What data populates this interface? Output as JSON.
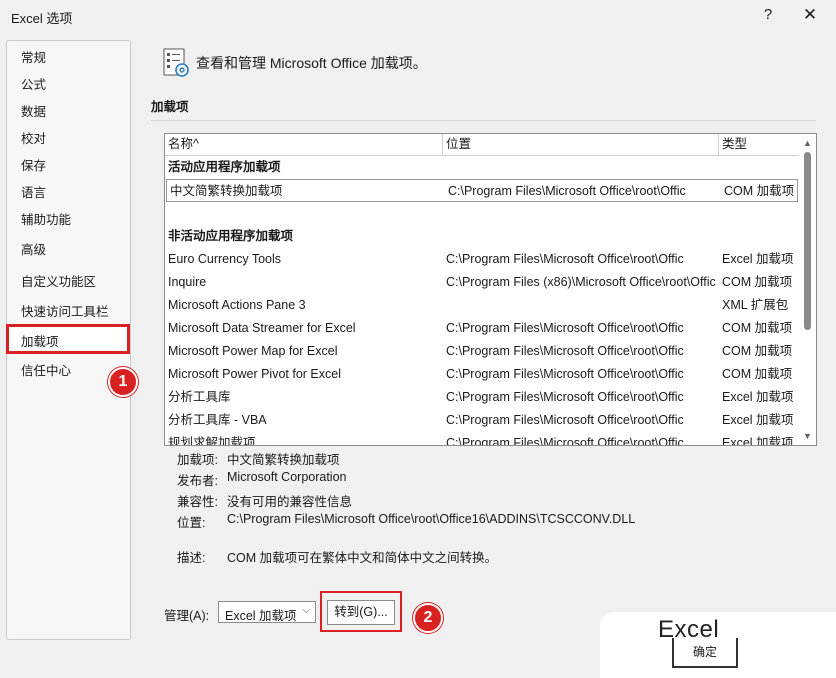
{
  "window": {
    "title": "Excel 选项",
    "help": "?",
    "close": "✕"
  },
  "sidebar": {
    "items": [
      {
        "label": "常规"
      },
      {
        "label": "公式"
      },
      {
        "label": "数据"
      },
      {
        "label": "校对"
      },
      {
        "label": "保存"
      },
      {
        "label": "语言"
      },
      {
        "label": "辅助功能"
      },
      {
        "label": "高级"
      },
      {
        "label": "自定义功能区"
      },
      {
        "label": "快速访问工具栏"
      },
      {
        "label": "加载项"
      },
      {
        "label": "信任中心"
      }
    ],
    "selected_label": "加载项"
  },
  "badges": {
    "one": "1",
    "two": "2"
  },
  "header": {
    "text": "查看和管理 Microsoft Office 加载项。"
  },
  "section": {
    "title": "加载项"
  },
  "list": {
    "columns": {
      "name": "名称^",
      "location": "位置",
      "type": "类型"
    },
    "active_group": "活动应用程序加载项",
    "inactive_group": "非活动应用程序加载项",
    "active_rows": [
      {
        "name": "中文简繁转换加载项",
        "location": "C:\\Program Files\\Microsoft Office\\root\\Offic",
        "type": "COM 加载项"
      }
    ],
    "inactive_rows": [
      {
        "name": "Euro Currency Tools",
        "location": "C:\\Program Files\\Microsoft Office\\root\\Offic",
        "type": "Excel 加载项"
      },
      {
        "name": "Inquire",
        "location": "C:\\Program Files (x86)\\Microsoft Office\\root\\Offic",
        "type": "COM 加载项"
      },
      {
        "name": "Microsoft Actions Pane 3",
        "location": "",
        "type": "XML 扩展包"
      },
      {
        "name": "Microsoft Data Streamer for Excel",
        "location": "C:\\Program Files\\Microsoft Office\\root\\Offic",
        "type": "COM 加载项"
      },
      {
        "name": "Microsoft Power Map for Excel",
        "location": "C:\\Program Files\\Microsoft Office\\root\\Offic",
        "type": "COM 加载项"
      },
      {
        "name": "Microsoft Power Pivot for Excel",
        "location": "C:\\Program Files\\Microsoft Office\\root\\Offic",
        "type": "COM 加载项"
      },
      {
        "name": "分析工具库",
        "location": "C:\\Program Files\\Microsoft Office\\root\\Offic",
        "type": "Excel 加载项"
      },
      {
        "name": "分析工具库 - VBA",
        "location": "C:\\Program Files\\Microsoft Office\\root\\Offic",
        "type": "Excel 加载项"
      },
      {
        "name": "规划求解加载项",
        "location": "C:\\Program Files\\Microsoft Office\\root\\Offic",
        "type": "Excel 加载项"
      }
    ]
  },
  "details": {
    "addin_label": "加载项:",
    "addin_value": "中文简繁转换加载项",
    "publisher_label": "发布者:",
    "publisher_value": "Microsoft Corporation",
    "compat_label": "兼容性:",
    "compat_value": "没有可用的兼容性信息",
    "location_label": "位置:",
    "location_value": "C:\\Program Files\\Microsoft Office\\root\\Office16\\ADDINS\\TCSCCONV.DLL",
    "desc_label": "描述:",
    "desc_value": "COM 加载项可在繁体中文和简体中文之间转换。"
  },
  "manage": {
    "label": "管理(A):",
    "selected": "Excel 加载项",
    "go_button": "转到(G)..."
  },
  "watermark": {
    "text": "Excel"
  },
  "ok_button": "确定"
}
